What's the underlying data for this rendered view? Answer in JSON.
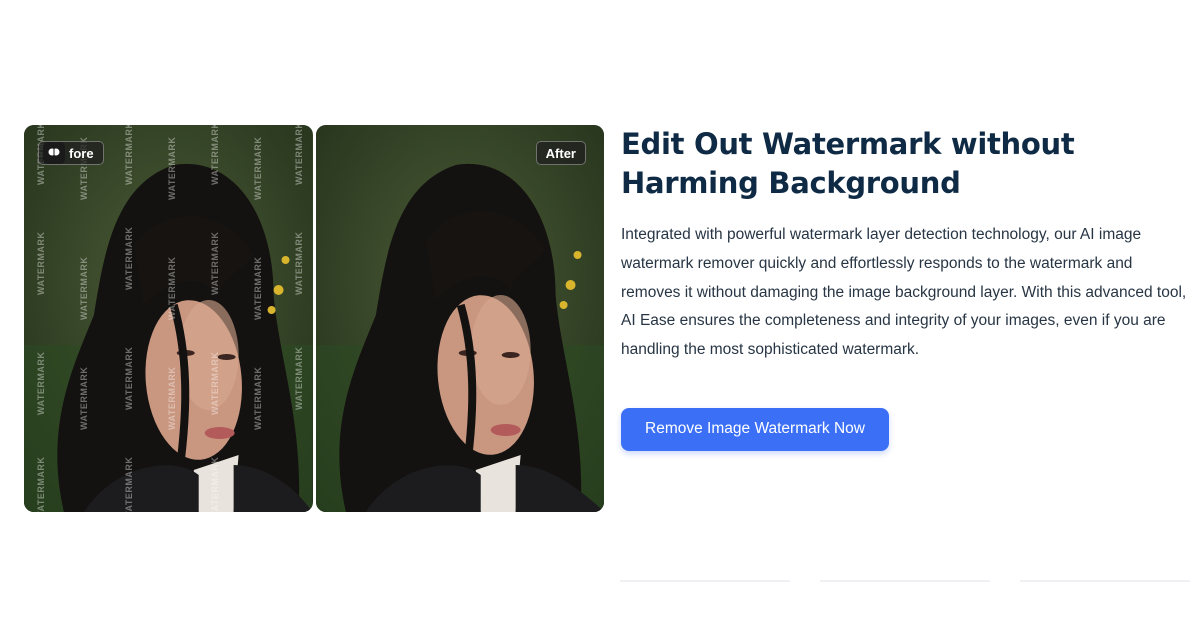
{
  "comparison": {
    "before_label": "Before",
    "before_visible_label": "fore",
    "after_label": "After",
    "watermark_text": "WATERMARK",
    "logo_icon": "brain-icon"
  },
  "section": {
    "title": "Edit Out Watermark without Harming Background",
    "description": "Integrated with powerful watermark layer detection technology, our AI image watermark remover quickly and effortlessly responds to the watermark and removes it without damaging the image background layer. With this advanced tool, AI Ease ensures the completeness and integrity of your images, even if you are handling the most sophisticated watermark.",
    "cta_label": "Remove Image Watermark Now"
  },
  "colors": {
    "accent": "#3b6ff5",
    "title": "#0f2a44",
    "text": "#273544"
  }
}
